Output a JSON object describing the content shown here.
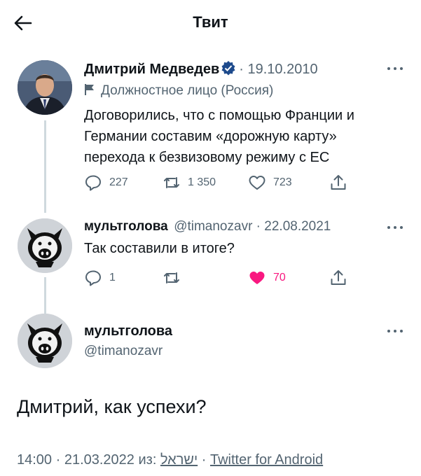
{
  "header": {
    "title": "Твит"
  },
  "tweet1": {
    "name": "Дмитрий Медведев",
    "date": "· 19.10.2010",
    "label": "Должностное лицо (Россия)",
    "text_lines": [
      "Договорились, что с помощью Франции и",
      "Германии составим «дорожную карту»",
      "перехода к безвизовому режиму с ЕС"
    ],
    "replies": "227",
    "retweets": "1 350",
    "likes": "723"
  },
  "tweet2": {
    "name": "мультголова",
    "handle_date": "@timanozavr · 22.08.2021",
    "text": "Так составили в итоге?",
    "replies": "1",
    "likes": "70",
    "like_color": "#f91880"
  },
  "main_tweet": {
    "name": "мультголова",
    "handle": "@timanozavr",
    "text": "Дмитрий, как успехи?",
    "time_date": "14:00 · 21.03.2022 из:",
    "place": "ישראל",
    "separator": "·",
    "source": "Twitter for Android"
  },
  "colors": {
    "accent": "#1d9bf0",
    "text": "#0f1419",
    "muted": "#536471",
    "like": "#f91880"
  }
}
